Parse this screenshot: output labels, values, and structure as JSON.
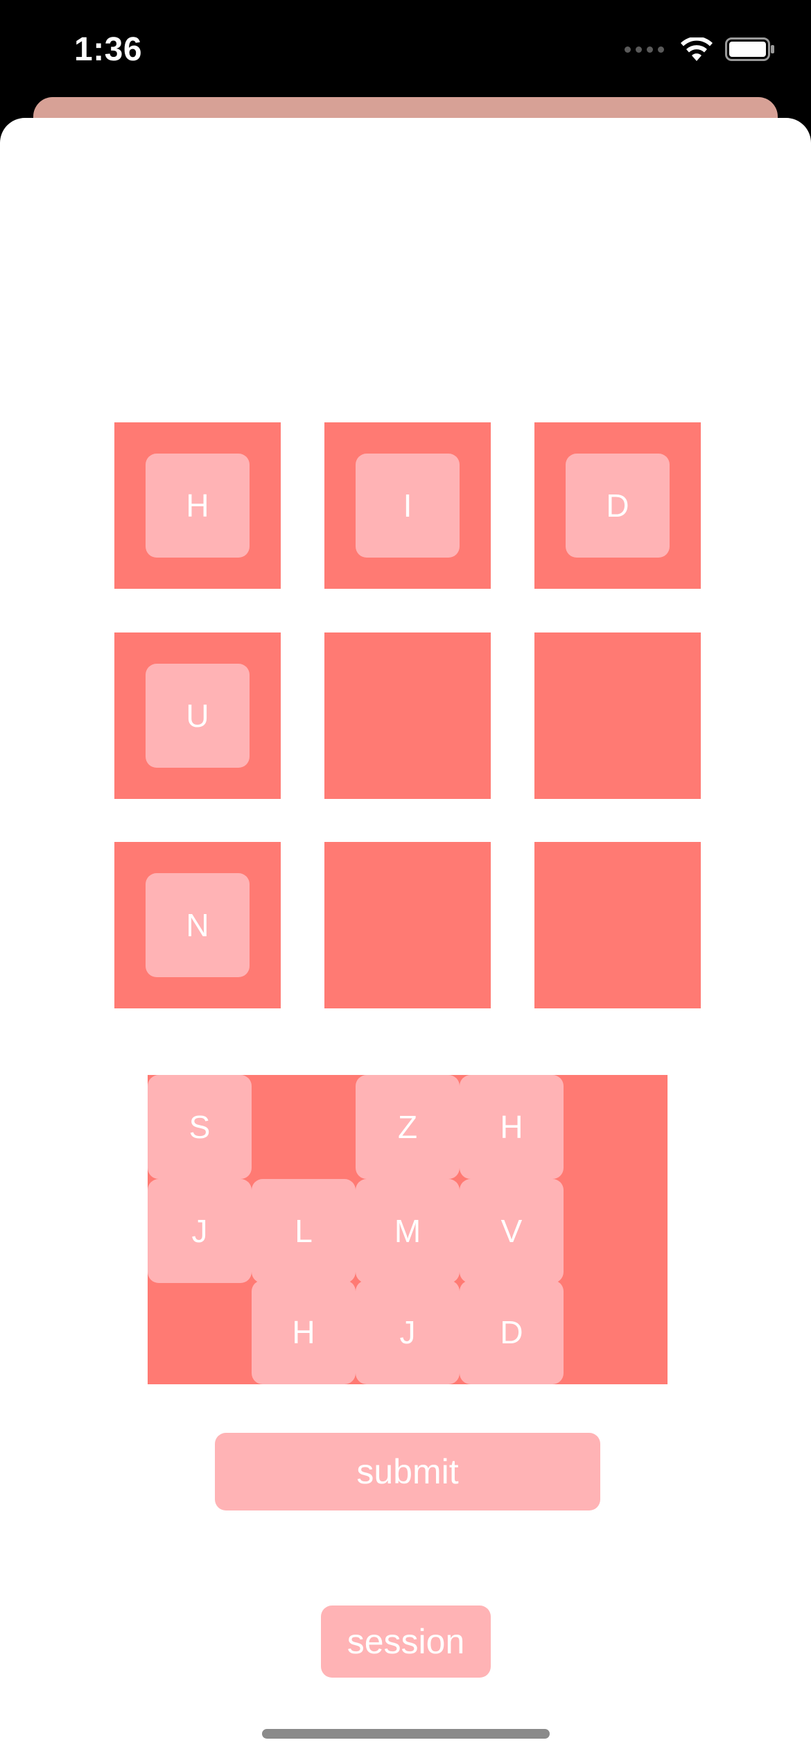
{
  "status_bar": {
    "time": "1:36"
  },
  "grid": {
    "cells": [
      {
        "letter": "H"
      },
      {
        "letter": "I"
      },
      {
        "letter": "D"
      },
      {
        "letter": "U"
      },
      {
        "letter": ""
      },
      {
        "letter": ""
      },
      {
        "letter": "N"
      },
      {
        "letter": ""
      },
      {
        "letter": ""
      }
    ]
  },
  "letter_bank": {
    "tiles": [
      "S",
      "Z",
      "H",
      "J",
      "L",
      "M",
      "V",
      "H",
      "J",
      "D"
    ]
  },
  "buttons": {
    "submit_label": "submit",
    "session_label": "session"
  },
  "colors": {
    "cell_background": "#ff7a73",
    "tile_background": "#ffb3b5",
    "back_sheet": "#d7a196"
  },
  "icons": {
    "wifi": "wifi-icon",
    "battery": "battery-icon",
    "signal": "cellular-signal-icon"
  }
}
